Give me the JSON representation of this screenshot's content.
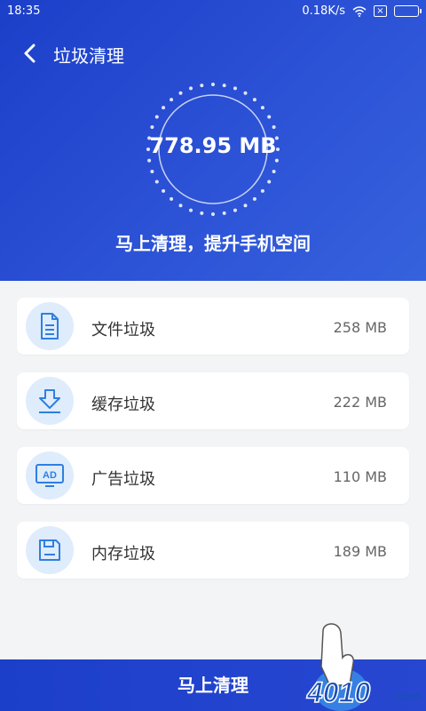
{
  "statusbar": {
    "time": "18:35",
    "speed": "0.18K/s"
  },
  "header": {
    "title": "垃圾清理",
    "size": "778.95 MB",
    "slogan": "马上清理，提升手机空间"
  },
  "items": [
    {
      "label": "文件垃圾",
      "value": "258 MB",
      "icon": "file-icon"
    },
    {
      "label": "缓存垃圾",
      "value": "222 MB",
      "icon": "download-icon"
    },
    {
      "label": "广告垃圾",
      "value": "110 MB",
      "icon": "ad-icon"
    },
    {
      "label": "内存垃圾",
      "value": "189 MB",
      "icon": "memory-icon"
    }
  ],
  "bottom": {
    "button_label": "马上清理"
  },
  "watermark": {
    "text": "4010",
    "suffix": ".com"
  },
  "colors": {
    "primary": "#1c3fc9",
    "icon_blue": "#2f7fe0",
    "icon_bg": "#dfecfb"
  }
}
